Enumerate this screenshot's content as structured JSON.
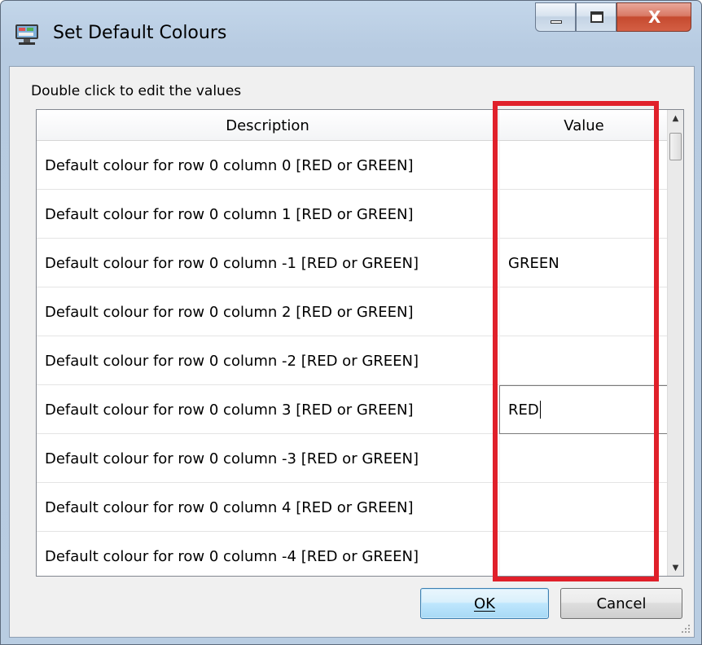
{
  "window": {
    "title": "Set Default Colours",
    "app_icon": "monitor-icon"
  },
  "titlebar_buttons": {
    "minimize_icon": "minimize-icon",
    "maximize_icon": "maximize-icon",
    "close_icon": "close-icon",
    "close_glyph": "X"
  },
  "hint": "Double click to edit the values",
  "table": {
    "columns": [
      "Description",
      "Value"
    ],
    "rows": [
      {
        "description": "Default colour for row 0 column 0 [RED or GREEN]",
        "value": ""
      },
      {
        "description": "Default colour for row 0 column 1 [RED or GREEN]",
        "value": ""
      },
      {
        "description": "Default colour for row 0 column -1 [RED or GREEN]",
        "value": "GREEN"
      },
      {
        "description": "Default colour for row 0 column 2 [RED or GREEN]",
        "value": ""
      },
      {
        "description": "Default colour for row 0 column -2 [RED or GREEN]",
        "value": ""
      },
      {
        "description": "Default colour for row 0 column 3 [RED or GREEN]",
        "value": "RED"
      },
      {
        "description": "Default colour for row 0 column -3 [RED or GREEN]",
        "value": ""
      },
      {
        "description": "Default colour for row 0 column 4 [RED or GREEN]",
        "value": ""
      },
      {
        "description": "Default colour for row 0 column -4 [RED or GREEN]",
        "value": ""
      }
    ],
    "editing_row": 5
  },
  "scrollbar": {
    "up_icon": "scroll-up-arrow-icon",
    "down_icon": "scroll-down-arrow-icon"
  },
  "buttons": {
    "ok_label": "OK",
    "cancel_label": "Cancel"
  },
  "colors": {
    "highlight": "#e0202a",
    "ok_border": "#3c7fb1"
  }
}
